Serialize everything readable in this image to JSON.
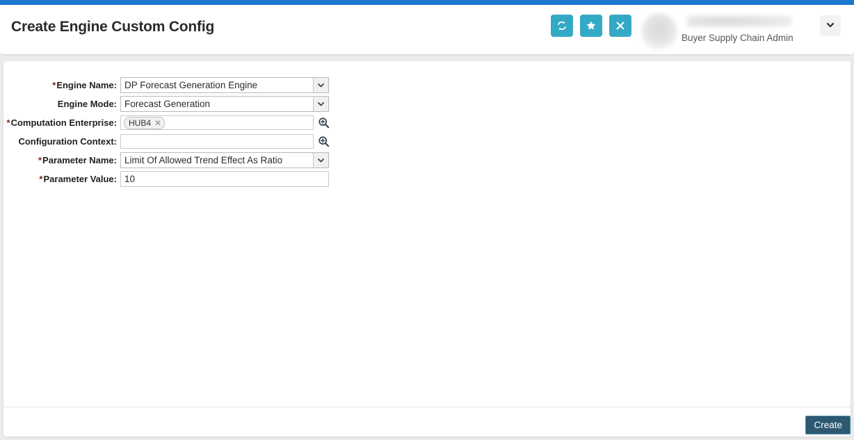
{
  "theme": {
    "accent_blue": "#1b78d0",
    "action_teal": "#34a9c6",
    "required_red": "#8f1a14",
    "create_button_bg": "#2d5871"
  },
  "header": {
    "title": "Create Engine Custom Config",
    "actions": [
      {
        "name": "refresh-button",
        "icon": "refresh-icon"
      },
      {
        "name": "favorite-button",
        "icon": "star-icon"
      },
      {
        "name": "close-button",
        "icon": "close-icon"
      }
    ],
    "user": {
      "role": "Buyer Supply Chain Admin",
      "name_redacted": true,
      "avatar_redacted": true,
      "caret_icon": "chevron-down-icon"
    }
  },
  "form": {
    "fields": [
      {
        "label": "Engine Name:",
        "required": true,
        "type": "select",
        "value": "DP Forecast Generation Engine"
      },
      {
        "label": "Engine Mode:",
        "required": false,
        "type": "select",
        "value": "Forecast Generation"
      },
      {
        "label": "Computation Enterprise:",
        "required": true,
        "type": "lookup",
        "value": "",
        "tokens": [
          "HUB4"
        ],
        "icon": "search-plus-icon"
      },
      {
        "label": "Configuration Context:",
        "required": false,
        "type": "lookup",
        "value": "",
        "tokens": [],
        "icon": "search-plus-icon"
      },
      {
        "label": "Parameter Name:",
        "required": true,
        "type": "select",
        "value": "Limit Of Allowed Trend Effect As Ratio"
      },
      {
        "label": "Parameter Value:",
        "required": true,
        "type": "text",
        "value": "10"
      }
    ]
  },
  "footer": {
    "create_label": "Create"
  }
}
